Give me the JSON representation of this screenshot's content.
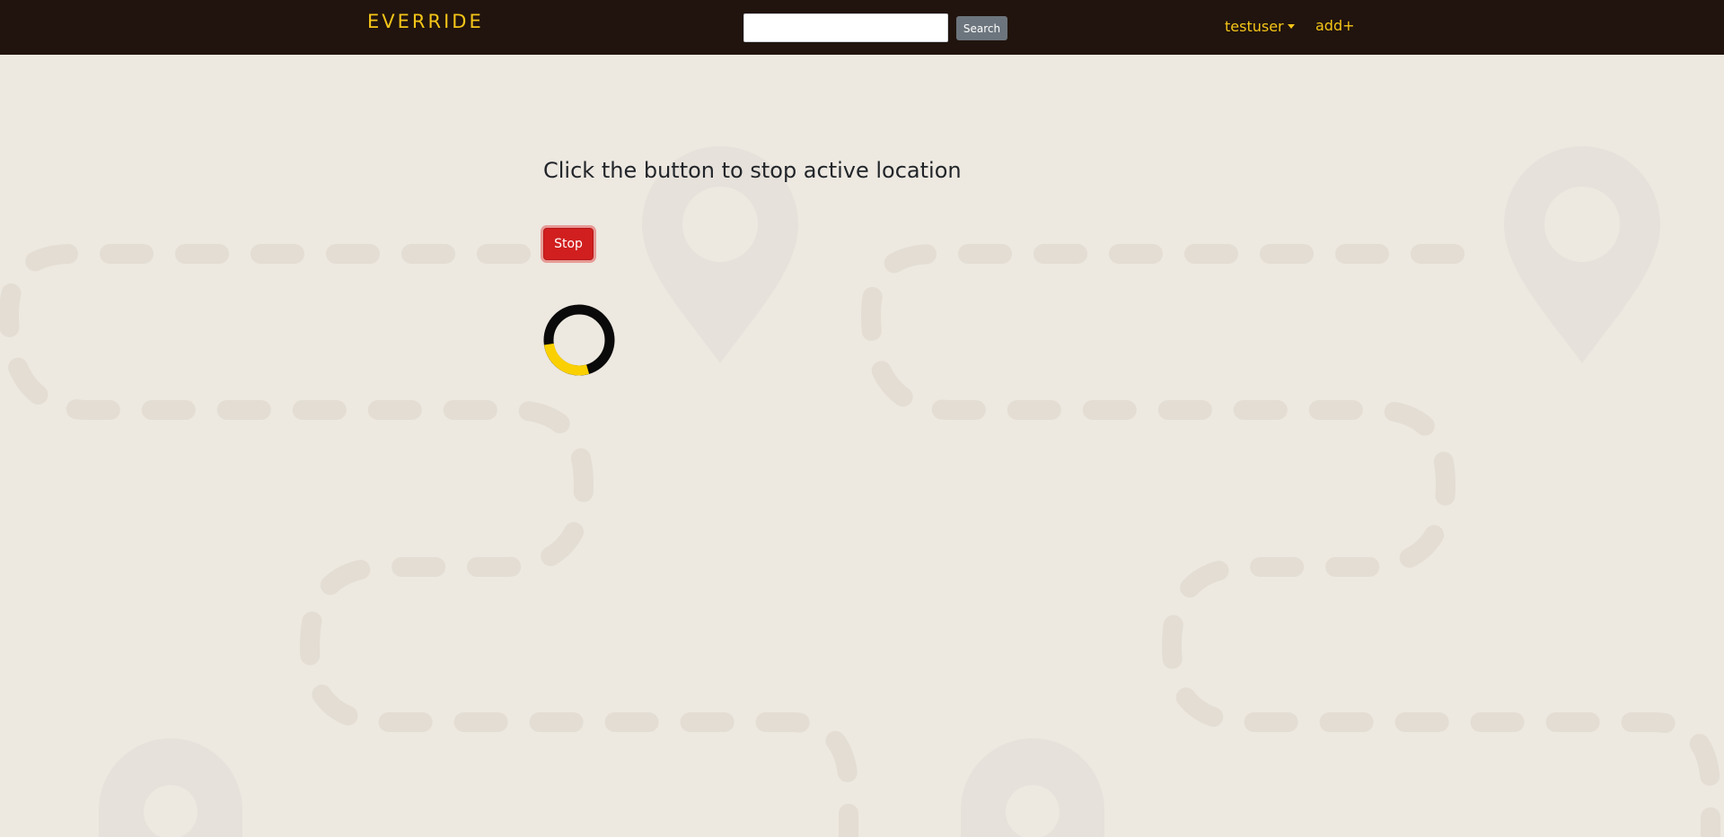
{
  "navbar": {
    "brand": "EVERRIDE",
    "search": {
      "value": "",
      "placeholder": "",
      "button_label": "Search"
    },
    "user_menu_label": "testuser",
    "add_label": "add+"
  },
  "main": {
    "instruction": "Click the button to stop active location",
    "stop_button_label": "Stop",
    "spinner_icon": "loading-spinner-icon"
  },
  "colors": {
    "navbar_bg": "#21140e",
    "accent": "#f5c518",
    "page_bg": "#ede8e0",
    "stop_button": "#d11f1f",
    "search_button": "#6c757d"
  }
}
